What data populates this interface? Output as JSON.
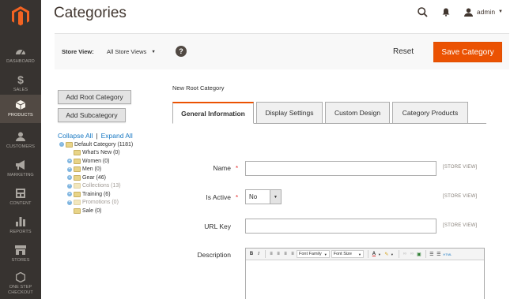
{
  "sidebar": {
    "logo": "magento-logo-icon",
    "items": [
      {
        "label": "DASHBOARD",
        "icon": "dashboard-icon"
      },
      {
        "label": "SALES",
        "icon": "dollar-icon"
      },
      {
        "label": "PRODUCTS",
        "icon": "cube-icon",
        "active": true
      },
      {
        "label": "CUSTOMERS",
        "icon": "user-icon"
      },
      {
        "label": "MARKETING",
        "icon": "megaphone-icon"
      },
      {
        "label": "CONTENT",
        "icon": "layout-icon"
      },
      {
        "label": "REPORTS",
        "icon": "bar-chart-icon"
      },
      {
        "label": "STORES",
        "icon": "storefront-icon"
      },
      {
        "label_line1": "ONE STEP",
        "label_line2": "CHECKOUT",
        "icon": "hexagon-icon"
      }
    ]
  },
  "header": {
    "title": "Categories",
    "search_icon": "search-icon",
    "notifications_icon": "bell-icon",
    "user_icon": "user-icon",
    "user_name": "admin"
  },
  "toolbar": {
    "store_view_label": "Store View:",
    "store_view_value": "All Store Views",
    "help": "?",
    "reset_label": "Reset",
    "save_label": "Save Category"
  },
  "tree_panel": {
    "add_root_label": "Add Root Category",
    "add_sub_label": "Add Subcategory",
    "collapse_all": "Collapse All",
    "separator": "|",
    "expand_all": "Expand All",
    "nodes": [
      {
        "label": "Default Category (1181)"
      },
      {
        "label": "What's New (0)"
      },
      {
        "label": "Women (0)"
      },
      {
        "label": "Men (0)"
      },
      {
        "label": "Gear (46)"
      },
      {
        "label": "Collections (13)"
      },
      {
        "label": "Training (6)"
      },
      {
        "label": "Promotions (0)"
      },
      {
        "label": "Sale (0)"
      }
    ]
  },
  "form": {
    "title": "New Root Category",
    "tabs": [
      {
        "label": "General Information",
        "active": true
      },
      {
        "label": "Display Settings"
      },
      {
        "label": "Custom Design"
      },
      {
        "label": "Category Products"
      }
    ],
    "fields": {
      "name_label": "Name",
      "required_mark": "*",
      "name_scope": "[STORE VIEW]",
      "is_active_label": "Is Active",
      "is_active_value": "No",
      "is_active_scope": "[STORE VIEW]",
      "url_key_label": "URL Key",
      "url_key_scope": "[STORE VIEW]",
      "description_label": "Description"
    },
    "editor": {
      "bold": "B",
      "italic": "I",
      "font_family": "Font Family",
      "font_size": "Font Size",
      "text_color": "A",
      "html": "HTML"
    }
  }
}
